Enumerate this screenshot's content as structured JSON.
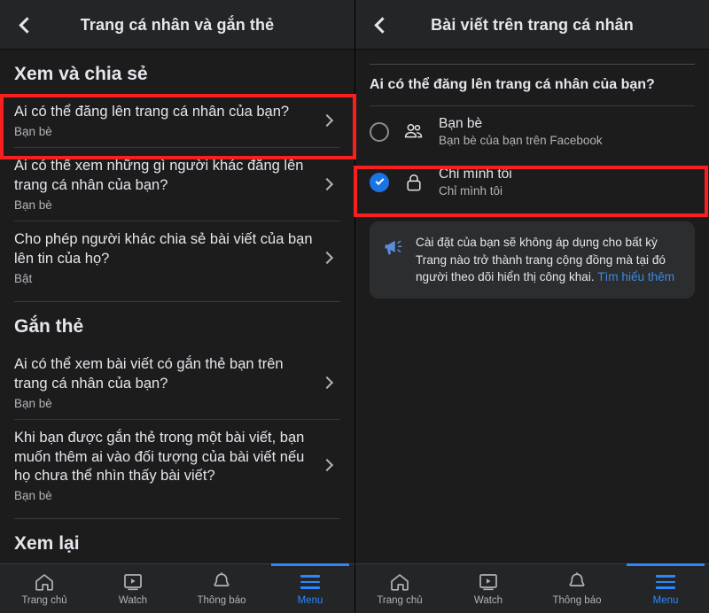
{
  "left_panel": {
    "header": {
      "back_icon": "chevron-left-icon",
      "title": "Trang cá nhân và gắn thẻ"
    },
    "sections": [
      {
        "title": "Xem và chia sẻ",
        "rows": [
          {
            "title": "Ai có thể đăng lên trang cá nhân của bạn?",
            "value": "Bạn bè",
            "chevron": "chevron-right-icon",
            "highlighted": true
          },
          {
            "title": "Ai có thể xem những gì người khác đăng lên trang cá nhân của bạn?",
            "value": "Bạn bè",
            "chevron": "chevron-right-icon",
            "highlighted": false
          },
          {
            "title": "Cho phép người khác chia sẻ bài viết của bạn lên tin của họ?",
            "value": "Bật",
            "chevron": "chevron-right-icon",
            "highlighted": false
          }
        ]
      },
      {
        "title": "Gắn thẻ",
        "rows": [
          {
            "title": "Ai có thể xem bài viết có gắn thẻ bạn trên trang cá nhân của bạn?",
            "value": "Bạn bè",
            "chevron": "chevron-right-icon",
            "highlighted": false
          },
          {
            "title": "Khi bạn được gắn thẻ trong một bài viết, bạn muốn thêm ai vào đối tượng của bài viết nếu họ chưa thể nhìn thấy bài viết?",
            "value": "Bạn bè",
            "chevron": "chevron-right-icon",
            "highlighted": false
          }
        ]
      },
      {
        "title": "Xem lại",
        "rows": []
      }
    ]
  },
  "right_panel": {
    "header": {
      "back_icon": "chevron-left-icon",
      "title": "Bài viết trên trang cá nhân"
    },
    "question": "Ai có thể đăng lên trang cá nhân của bạn?",
    "options": [
      {
        "title": "Bạn bè",
        "subtitle": "Bạn bè của bạn trên Facebook",
        "icon": "friends-icon",
        "selected": false,
        "highlighted": false
      },
      {
        "title": "Chỉ mình tôi",
        "subtitle": "Chỉ mình tôi",
        "icon": "lock-icon",
        "selected": true,
        "highlighted": true
      }
    ],
    "notice": {
      "icon": "megaphone-icon",
      "text": "Cài đặt của bạn sẽ không áp dụng cho bất kỳ Trang nào trở thành trang cộng đồng mà tại đó người theo dõi hiển thị công khai. ",
      "link": "Tìm hiểu thêm"
    }
  },
  "bottom_nav": {
    "items": [
      {
        "label": "Trang chủ",
        "icon": "home-icon",
        "active": false
      },
      {
        "label": "Watch",
        "icon": "watch-icon",
        "active": false
      },
      {
        "label": "Thông báo",
        "icon": "bell-icon",
        "active": false
      },
      {
        "label": "Menu",
        "icon": "hamburger-menu-icon",
        "active": true
      }
    ]
  },
  "colors": {
    "accent_blue": "#2d88ff",
    "selected_blue": "#1b74e4",
    "link_blue": "#3f88e0",
    "highlight_red": "#f81f1f",
    "background": "#1c1c1d",
    "header_bg": "#242526",
    "primary_text": "#e4e6eb",
    "secondary_text": "#b0b3b8"
  }
}
